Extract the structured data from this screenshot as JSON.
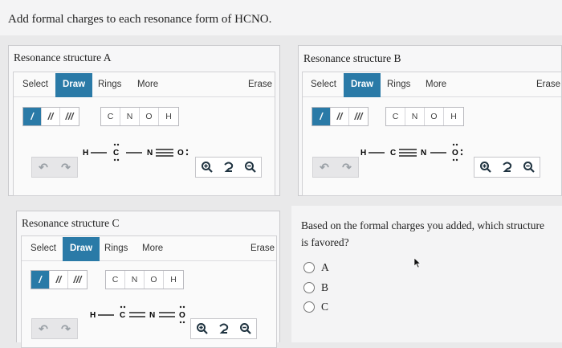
{
  "question": "Add formal charges to each resonance form of HCNO.",
  "toolbar": {
    "select": "Select",
    "draw": "Draw",
    "rings": "Rings",
    "more": "More",
    "erase": "Erase"
  },
  "bonds": [
    "/",
    "//",
    "///"
  ],
  "atoms": [
    "C",
    "N",
    "O",
    "H"
  ],
  "panels": {
    "a": {
      "title": "Resonance structure A"
    },
    "b": {
      "title": "Resonance structure B"
    },
    "c": {
      "title": "Resonance structure C"
    }
  },
  "molecules": {
    "a": {
      "h": "H",
      "c": "C",
      "n": "N",
      "o": "O"
    },
    "b": {
      "h": "H",
      "c": "C",
      "n": "N",
      "o": "O"
    },
    "c": {
      "h": "H",
      "c": "C",
      "n": "N",
      "o": "O"
    }
  },
  "quiz": {
    "prompt": "Based on the formal charges you added, which structure is favored?",
    "options": [
      "A",
      "B",
      "C"
    ]
  },
  "icons": {
    "undo": "undo-icon",
    "redo": "redo-icon",
    "zoom_in": "zoom-in-icon",
    "reset": "reset-zoom-icon",
    "zoom_out": "zoom-out-icon"
  },
  "colors": {
    "accent": "#2a7aa7",
    "icon_dark": "#1f3340"
  }
}
